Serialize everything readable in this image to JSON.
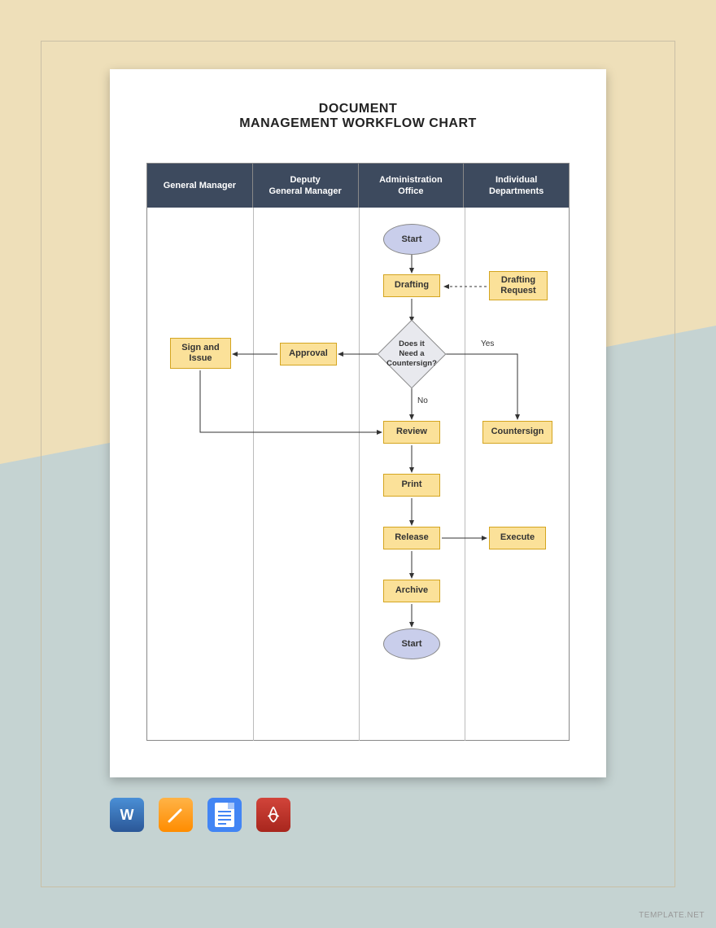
{
  "title": {
    "line1": "DOCUMENT",
    "line2": "MANAGEMENT WORKFLOW CHART"
  },
  "lanes": [
    "General Manager",
    "Deputy\nGeneral Manager",
    "Administration\nOffice",
    "Individual\nDepartments"
  ],
  "nodes": {
    "start": "Start",
    "drafting": "Drafting",
    "drafting_request": "Drafting\nRequest",
    "decision": "Does it\nNeed a\nCountersign?",
    "yes": "Yes",
    "no": "No",
    "approval": "Approval",
    "sign_issue": "Sign and\nIssue",
    "countersign": "Countersign",
    "review": "Review",
    "print": "Print",
    "release": "Release",
    "execute": "Execute",
    "archive": "Archive",
    "end": "Start"
  },
  "watermark": "TEMPLATE.NET",
  "icons": [
    "word",
    "pages",
    "gdoc",
    "pdf"
  ],
  "chart_data": {
    "type": "swimlane-flowchart",
    "title": "Document Management Workflow Chart",
    "lanes": [
      "General Manager",
      "Deputy General Manager",
      "Administration Office",
      "Individual Departments"
    ],
    "nodes": [
      {
        "id": "start",
        "label": "Start",
        "shape": "terminator",
        "lane": "Administration Office"
      },
      {
        "id": "drafting",
        "label": "Drafting",
        "shape": "process",
        "lane": "Administration Office"
      },
      {
        "id": "drafting_request",
        "label": "Drafting Request",
        "shape": "process",
        "lane": "Individual Departments"
      },
      {
        "id": "decision",
        "label": "Does it Need a Countersign?",
        "shape": "decision",
        "lane": "Administration Office"
      },
      {
        "id": "approval",
        "label": "Approval",
        "shape": "process",
        "lane": "Deputy General Manager"
      },
      {
        "id": "sign_issue",
        "label": "Sign and Issue",
        "shape": "process",
        "lane": "General Manager"
      },
      {
        "id": "countersign",
        "label": "Countersign",
        "shape": "process",
        "lane": "Individual Departments"
      },
      {
        "id": "review",
        "label": "Review",
        "shape": "process",
        "lane": "Administration Office"
      },
      {
        "id": "print",
        "label": "Print",
        "shape": "process",
        "lane": "Administration Office"
      },
      {
        "id": "release",
        "label": "Release",
        "shape": "process",
        "lane": "Administration Office"
      },
      {
        "id": "execute",
        "label": "Execute",
        "shape": "process",
        "lane": "Individual Departments"
      },
      {
        "id": "archive",
        "label": "Archive",
        "shape": "process",
        "lane": "Administration Office"
      },
      {
        "id": "end",
        "label": "Start",
        "shape": "terminator",
        "lane": "Administration Office"
      }
    ],
    "edges": [
      {
        "from": "start",
        "to": "drafting"
      },
      {
        "from": "drafting_request",
        "to": "drafting",
        "style": "dashed"
      },
      {
        "from": "drafting",
        "to": "decision"
      },
      {
        "from": "decision",
        "to": "countersign",
        "label": "Yes"
      },
      {
        "from": "decision",
        "to": "approval"
      },
      {
        "from": "approval",
        "to": "sign_issue"
      },
      {
        "from": "decision",
        "to": "review",
        "label": "No"
      },
      {
        "from": "sign_issue",
        "to": "review"
      },
      {
        "from": "countersign",
        "to": "review"
      },
      {
        "from": "review",
        "to": "print"
      },
      {
        "from": "print",
        "to": "release"
      },
      {
        "from": "release",
        "to": "execute"
      },
      {
        "from": "release",
        "to": "archive"
      },
      {
        "from": "archive",
        "to": "end"
      }
    ]
  }
}
